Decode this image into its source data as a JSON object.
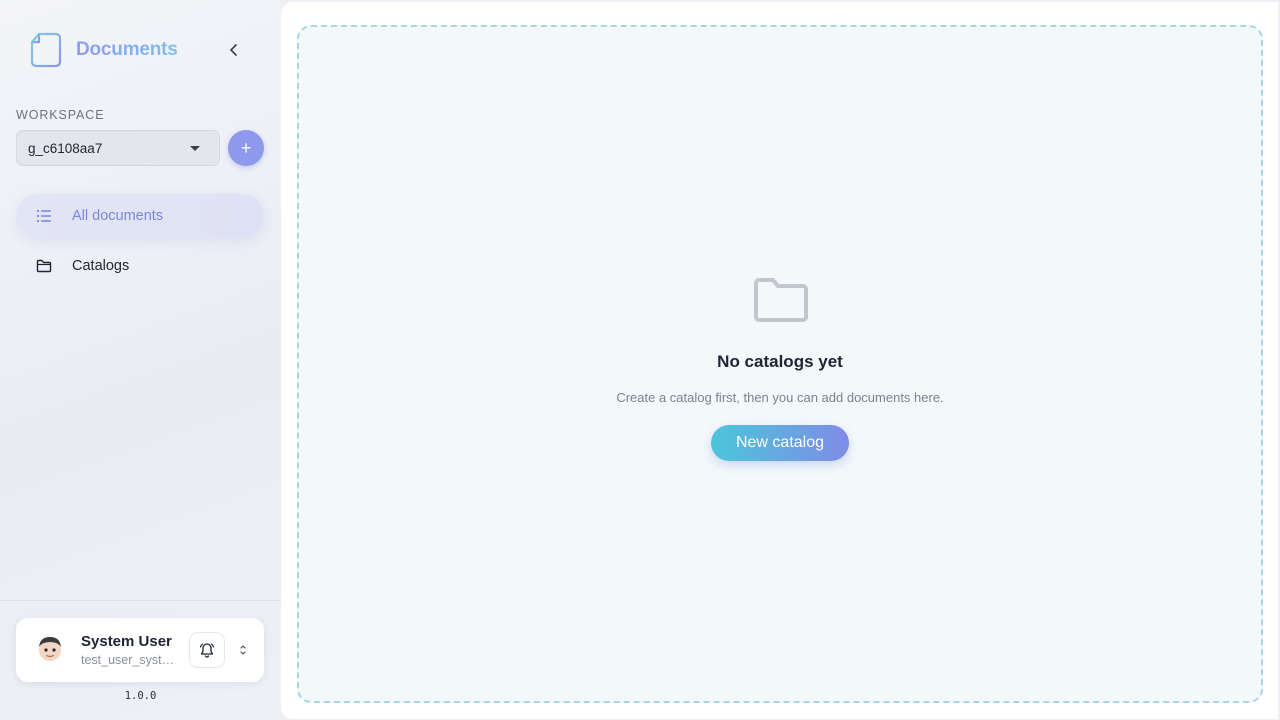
{
  "sidebar": {
    "brand_title": "Documents",
    "workspace_label": "WORKSPACE",
    "workspace_selected": "g_c6108aa7",
    "add_workspace_label": "+",
    "nav": [
      {
        "label": "All documents",
        "icon": "list-icon",
        "active": true
      },
      {
        "label": "Catalogs",
        "icon": "folder-icon",
        "active": false
      }
    ],
    "user": {
      "name": "System User",
      "id": "test_user_system"
    },
    "version": "1.0.0"
  },
  "main": {
    "empty_title": "No catalogs yet",
    "empty_desc": "Create a catalog first, then you can add documents here.",
    "new_catalog_label": "New catalog"
  },
  "colors": {
    "accent": "#8e98ec",
    "active_text": "#7b86d8",
    "dropzone_border": "#a9d6e4",
    "button_gradient_start": "#4cc5da",
    "button_gradient_end": "#7f8ce7"
  }
}
